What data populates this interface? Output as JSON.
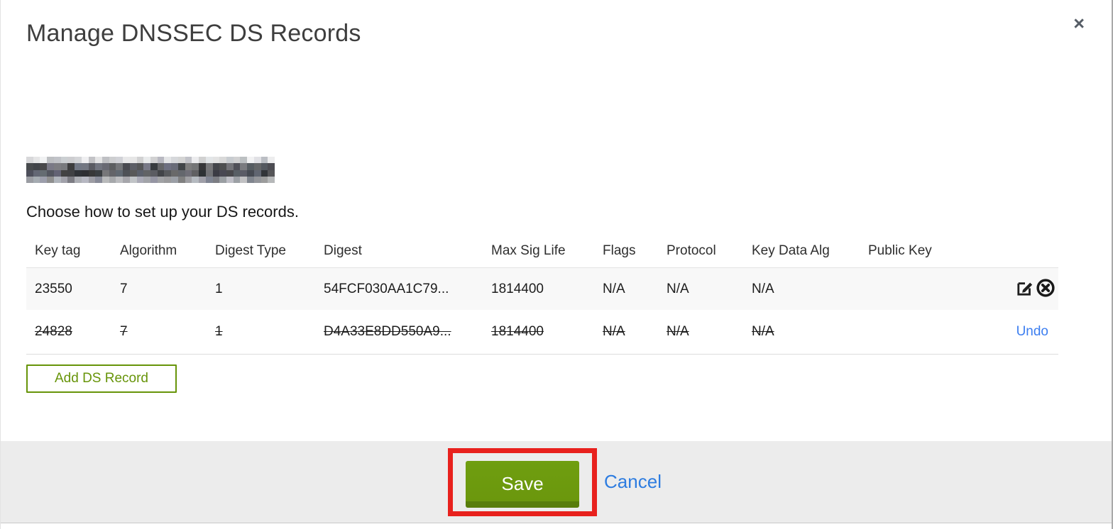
{
  "modal": {
    "title": "Manage DNSSEC DS Records",
    "close_icon": "×",
    "domain_name_redacted": "(redacted domain name)",
    "instruction": "Choose how to set up your DS records.",
    "table": {
      "columns": [
        "Key tag",
        "Algorithm",
        "Digest Type",
        "Digest",
        "Max Sig Life",
        "Flags",
        "Protocol",
        "Key Data Alg",
        "Public Key"
      ],
      "rows": [
        {
          "key_tag": "23550",
          "algorithm": "7",
          "digest_type": "1",
          "digest": "54FCF030AA1C79...",
          "max_sig_life": "1814400",
          "flags": "N/A",
          "protocol": "N/A",
          "key_data_alg": "N/A",
          "public_key": "",
          "state": "normal",
          "actions": [
            "edit",
            "delete"
          ]
        },
        {
          "key_tag": "24828",
          "algorithm": "7",
          "digest_type": "1",
          "digest": "D4A33E8DD550A9...",
          "max_sig_life": "1814400",
          "flags": "N/A",
          "protocol": "N/A",
          "key_data_alg": "N/A",
          "public_key": "",
          "state": "deleted",
          "actions": [
            "undo"
          ],
          "undo_label": "Undo"
        }
      ]
    },
    "add_button_label": "Add DS Record",
    "footer": {
      "save_label": "Save",
      "cancel_label": "Cancel"
    },
    "colors": {
      "accent_green": "#679409",
      "save_green": "#6b970d",
      "save_green_dark": "#587d0b",
      "link_blue": "#2d7ce0",
      "undo_blue": "#3c7ef0",
      "annotation_red": "#e8211d",
      "footer_bg": "#ececec",
      "row_alt_bg": "#f8f8f8",
      "title_gray": "#3e3e3e"
    }
  }
}
